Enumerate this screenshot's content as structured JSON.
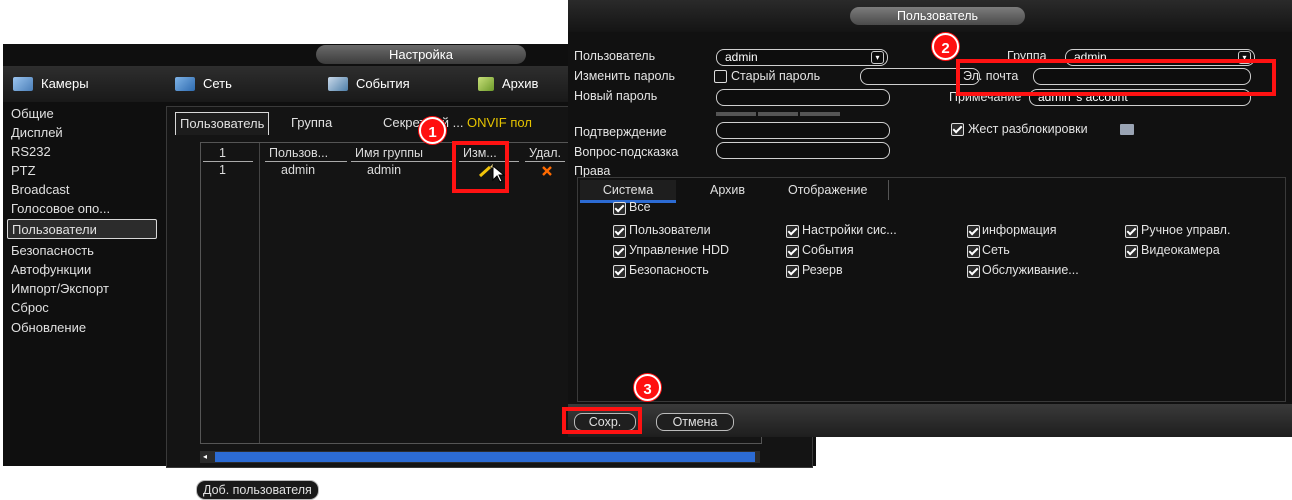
{
  "setup_window": {
    "title": "Настройка",
    "menu": [
      "Камеры",
      "Сеть",
      "События",
      "Архив"
    ],
    "sidebar": [
      "Общие",
      "Дисплей",
      "RS232",
      "PTZ",
      "Broadcast",
      "Голосовое опо...",
      "Пользователи",
      "Безопасность",
      "Автофункции",
      "Импорт/Экспорт",
      "Сброс",
      "Обновление"
    ],
    "active_sidebar": "Пользователи",
    "subtabs": [
      "Пользователь",
      "Группа",
      "Секретный ...",
      "ONVIF пол"
    ],
    "table": {
      "headers": [
        "1",
        "Пользов...",
        "Имя группы",
        "Изм...",
        "Удал."
      ],
      "row": {
        "num": "1",
        "user": "admin",
        "group": "admin",
        "edit_icon": "pencil-icon",
        "delete_icon": "x-icon"
      }
    },
    "add_user_label": "Доб. пользователя"
  },
  "user_dialog": {
    "title": "Пользователь",
    "user_label": "Пользователь",
    "user_value": "admin",
    "group_label": "Группа",
    "group_value": "admin",
    "change_pwd_label": "Изменить пароль",
    "old_pwd_label": "Старый пароль",
    "email_label": "Эл. почта",
    "new_pwd_label": "Новый пароль",
    "note_label": "Примечание",
    "note_value": "admin 's account",
    "confirm_label": "Подтверждение",
    "gesture_label": "Жест разблокировки",
    "hint_label": "Вопрос-подсказка",
    "rights_label": "Права",
    "perm_tabs": [
      "Система",
      "Архив",
      "Отображение"
    ],
    "all_label": "Все",
    "permissions": [
      [
        "Пользователи",
        "Настройки сис...",
        "информация",
        "Ручное управл."
      ],
      [
        "Управление HDD",
        "События",
        "Сеть",
        "Видеокамера"
      ],
      [
        "Безопасность",
        "Резерв",
        "Обслуживание..."
      ]
    ],
    "save_label": "Сохр.",
    "cancel_label": "Отмена"
  },
  "annotations": {
    "badge1": "1",
    "badge2": "2",
    "badge3": "3",
    "color": "#ff1212"
  }
}
